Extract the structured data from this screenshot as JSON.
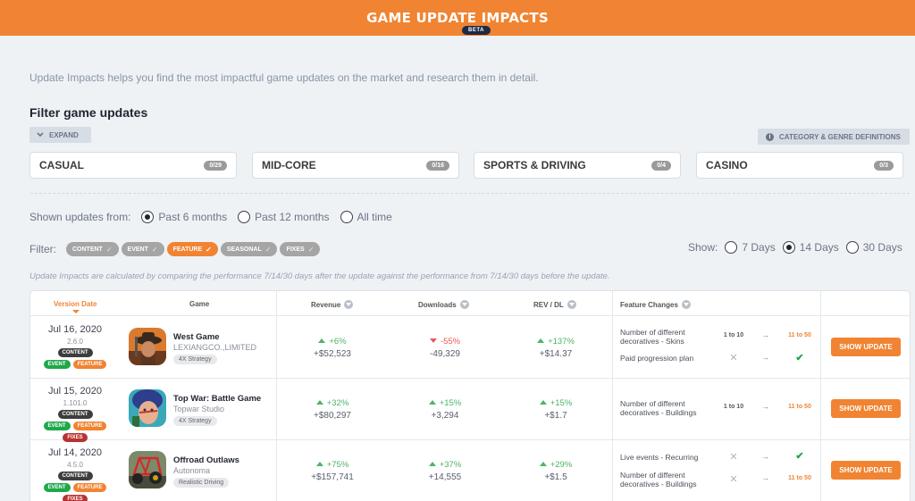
{
  "header": {
    "title": "GAME UPDATE IMPACTS",
    "badge": "BETA"
  },
  "intro": "Update Impacts helps you find the most impactful game updates on the market and research them in detail.",
  "filter_section": {
    "title": "Filter game updates",
    "expand_label": "EXPAND",
    "definitions_label": "CATEGORY & GENRE DEFINITIONS",
    "categories": [
      {
        "label": "CASUAL",
        "count": "0/29"
      },
      {
        "label": "MID-CORE",
        "count": "0/16"
      },
      {
        "label": "SPORTS & DRIVING",
        "count": "0/4"
      },
      {
        "label": "CASINO",
        "count": "0/3"
      }
    ]
  },
  "shown_updates": {
    "label": "Shown updates from:",
    "options": [
      {
        "label": "Past 6 months",
        "selected": true
      },
      {
        "label": "Past 12 months",
        "selected": false
      },
      {
        "label": "All time",
        "selected": false
      }
    ]
  },
  "filter_chips": {
    "label": "Filter:",
    "chips": [
      {
        "label": "CONTENT",
        "active": false
      },
      {
        "label": "EVENT",
        "active": false
      },
      {
        "label": "FEATURE",
        "active": true
      },
      {
        "label": "SEASONAL",
        "active": false
      },
      {
        "label": "FIXES",
        "active": false
      }
    ]
  },
  "show_days": {
    "label": "Show:",
    "options": [
      {
        "label": "7 Days",
        "selected": false
      },
      {
        "label": "14 Days",
        "selected": true
      },
      {
        "label": "30 Days",
        "selected": false
      }
    ]
  },
  "note": "Update Impacts are calculated by comparing the performance 7/14/30 days after the update against the performance from 7/14/30 days before the update.",
  "table": {
    "headers": {
      "version_date": "Version Date",
      "game": "Game",
      "revenue": "Revenue",
      "downloads": "Downloads",
      "rev_dl": "REV / DL",
      "feature_changes": "Feature Changes"
    },
    "show_update_label": "SHOW UPDATE",
    "rows": [
      {
        "date": "Jul 16, 2020",
        "version": "2.6.0",
        "tags": [
          "CONTENT",
          "EVENT",
          "FEATURE"
        ],
        "game": "West Game",
        "publisher": "LEXIANGCO.,LIMITED",
        "genre": "4X Strategy",
        "revenue_pct": "+6%",
        "revenue_dir": "up",
        "revenue_abs": "+$52,523",
        "downloads_pct": "-55%",
        "downloads_dir": "down",
        "downloads_abs": "-49,329",
        "revdl_pct": "+137%",
        "revdl_dir": "up",
        "revdl_abs": "+$14.37",
        "features": [
          {
            "name": "Number of different decoratives - Skins",
            "from": "1 to 10",
            "to": "11 to 50"
          },
          {
            "name": "Paid progression plan",
            "from": "x",
            "to": "check"
          }
        ]
      },
      {
        "date": "Jul 15, 2020",
        "version": "1.101.0",
        "tags": [
          "CONTENT",
          "EVENT",
          "FEATURE",
          "FIXES"
        ],
        "game": "Top War: Battle Game",
        "publisher": "Topwar Studio",
        "genre": "4X Strategy",
        "revenue_pct": "+32%",
        "revenue_dir": "up",
        "revenue_abs": "+$80,297",
        "downloads_pct": "+15%",
        "downloads_dir": "up",
        "downloads_abs": "+3,294",
        "revdl_pct": "+15%",
        "revdl_dir": "up",
        "revdl_abs": "+$1.7",
        "features": [
          {
            "name": "Number of different decoratives - Buildings",
            "from": "1 to 10",
            "to": "11 to 50"
          }
        ]
      },
      {
        "date": "Jul 14, 2020",
        "version": "4.5.0",
        "tags": [
          "CONTENT",
          "EVENT",
          "FEATURE",
          "FIXES"
        ],
        "game": "Offroad Outlaws",
        "publisher": "Autonoma",
        "genre": "Realistic Driving",
        "revenue_pct": "+75%",
        "revenue_dir": "up",
        "revenue_abs": "+$157,741",
        "downloads_pct": "+37%",
        "downloads_dir": "up",
        "downloads_abs": "+14,555",
        "revdl_pct": "+29%",
        "revdl_dir": "up",
        "revdl_abs": "+$1.5",
        "features": [
          {
            "name": "Live events - Recurring",
            "from": "x",
            "to": "check"
          },
          {
            "name": "Number of different decoratives - Buildings",
            "from": "x",
            "to": "11 to 50"
          }
        ]
      }
    ]
  },
  "colors": {
    "accent": "#f08432",
    "positive": "#4cb466",
    "negative": "#e85a5a",
    "tag_content": "#3d3d3d",
    "tag_event": "#1ea84a",
    "tag_fixes": "#b83232"
  }
}
